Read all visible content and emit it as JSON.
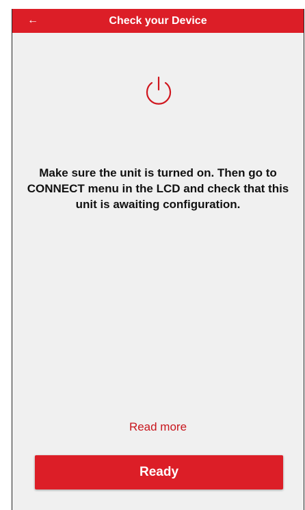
{
  "app_bar": {
    "title": "Check your Device",
    "back_icon": "←",
    "color": "#dc1e27"
  },
  "main": {
    "status_icon": "power-icon",
    "message": "Make sure the unit is turned on. Then go to CONNECT menu in the LCD and check that this unit is awaiting configuration.",
    "read_more_label": "Read more",
    "ready_label": "Ready"
  },
  "colors": {
    "accent": "#dc1e27",
    "background": "#f0f0f0"
  }
}
